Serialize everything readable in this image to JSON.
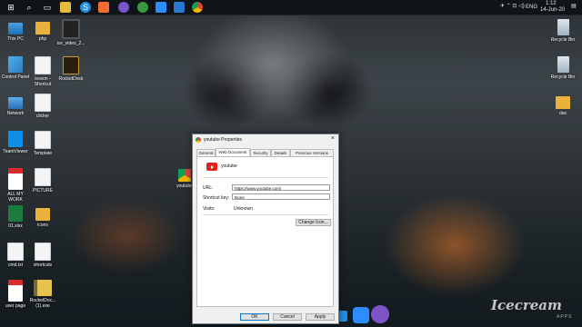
{
  "taskbar": {
    "apps": [
      {
        "name": "start-icon"
      },
      {
        "name": "search-icon"
      },
      {
        "name": "task-view-icon"
      },
      {
        "name": "file-explorer-icon"
      },
      {
        "name": "skype-icon"
      },
      {
        "name": "paint-icon"
      },
      {
        "name": "viber-icon"
      },
      {
        "name": "photos-icon"
      },
      {
        "name": "zoom-icon"
      },
      {
        "name": "mail-icon"
      },
      {
        "name": "chrome-icon"
      }
    ],
    "tray": {
      "language": "ENG",
      "time": "1:12",
      "date": "14-Jun-20"
    }
  },
  "desktop": {
    "icons": [
      {
        "label": "This PC",
        "type": "pc"
      },
      {
        "label": "php",
        "type": "folder"
      },
      {
        "label": "ice_video_2...",
        "type": "mp4"
      },
      {
        "label": "Control Panel",
        "type": "cp"
      },
      {
        "label": "lesson - Shortcut",
        "type": "doc"
      },
      {
        "label": "RocketDock",
        "type": "rd"
      },
      {
        "label": "Network",
        "type": "net"
      },
      {
        "label": "clicker",
        "type": "doc"
      },
      {
        "label": "TeamViewer",
        "type": "tv"
      },
      {
        "label": "Template",
        "type": "doc"
      },
      {
        "label": "ALL MY WORK",
        "type": "pdf"
      },
      {
        "label": "PICTURE",
        "type": "doc"
      },
      {
        "label": "01.xlsx",
        "type": "xls"
      },
      {
        "label": "icons",
        "type": "folder"
      },
      {
        "label": "cmd.txt",
        "type": "doc"
      },
      {
        "label": "shortcuts",
        "type": "doc"
      },
      {
        "label": "user page",
        "type": "pdf"
      },
      {
        "label": "RocketDoc... (1).exe",
        "type": "zip"
      },
      {
        "label": "youtube",
        "type": "chrome"
      },
      {
        "label": "Recycle Bin",
        "type": "bin"
      },
      {
        "label": "Recycle Bin",
        "type": "bin"
      },
      {
        "label": "das",
        "type": "folder"
      }
    ]
  },
  "dialog": {
    "title": "youtube Properties",
    "close": "×",
    "tabs": [
      "General",
      "Web Document",
      "Security",
      "Details",
      "Previous Versions"
    ],
    "active_tab": "Web Document",
    "name": "youtube",
    "url_label": "URL:",
    "url_value": "https://www.youtube.com/",
    "shortcut_label": "Shortcut key:",
    "shortcut_value": "None",
    "visits_label": "Visits:",
    "visits_value": "Unknown",
    "change_icon": "Change Icon...",
    "ok": "OK",
    "cancel": "Cancel",
    "apply": "Apply"
  },
  "watermark": {
    "brand": "Icecream",
    "sub": "APPS"
  },
  "colors": {
    "accent": "#0078d7",
    "youtube_red": "#e62117",
    "taskbar": "#101418"
  }
}
